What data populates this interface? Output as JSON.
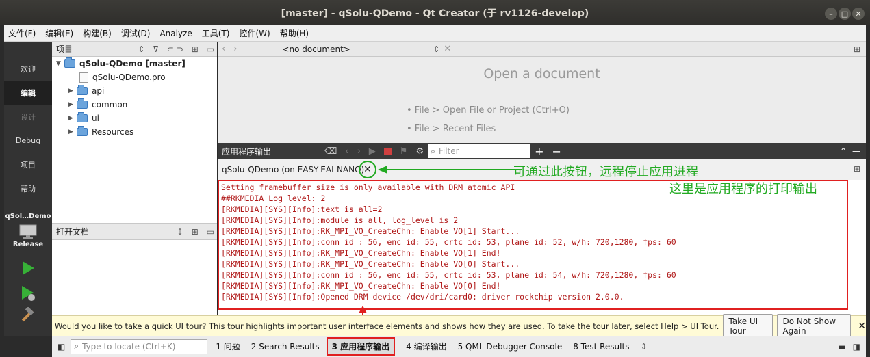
{
  "window": {
    "title": "[master] - qSolu-QDemo - Qt Creator (于 rv1126-develop)"
  },
  "menu": [
    "文件(F)",
    "编辑(E)",
    "构建(B)",
    "调试(D)",
    "Analyze",
    "工具(T)",
    "控件(W)",
    "帮助(H)"
  ],
  "modes": [
    {
      "label": "欢迎",
      "state": "normal"
    },
    {
      "label": "编辑",
      "state": "active"
    },
    {
      "label": "设计",
      "state": "dim"
    },
    {
      "label": "Debug",
      "state": "normal"
    },
    {
      "label": "项目",
      "state": "normal"
    },
    {
      "label": "帮助",
      "state": "normal"
    }
  ],
  "kit": {
    "project": "qSol…Demo",
    "build": "Release"
  },
  "projects": {
    "header": "项目",
    "root": "qSolu-QDemo [master]",
    "items": [
      "qSolu-QDemo.pro",
      "api",
      "common",
      "ui",
      "Resources"
    ]
  },
  "open_docs": {
    "header": "打开文档"
  },
  "editor": {
    "doc_selector": "<no document>",
    "title": "Open a document",
    "hints": [
      "• File > Open File or Project (Ctrl+O)",
      "• File > Recent Files"
    ]
  },
  "output": {
    "header": "应用程序输出",
    "filter_placeholder": "Filter",
    "tab": "qSolu-QDemo (on EASY-EAI-NANO)",
    "lines": [
      "Setting framebuffer size is only available with DRM atomic API",
      "##RKMEDIA Log level: 2",
      "[RKMEDIA][SYS][Info]:text is all=2",
      "[RKMEDIA][SYS][Info]:module is all, log_level is 2",
      "[RKMEDIA][SYS][Info]:RK_MPI_VO_CreateChn: Enable VO[1] Start...",
      "[RKMEDIA][SYS][Info]:conn id : 56, enc id: 55, crtc id: 53, plane id: 52, w/h: 720,1280, fps: 60",
      "[RKMEDIA][SYS][Info]:RK_MPI_VO_CreateChn: Enable VO[1] End!",
      "[RKMEDIA][SYS][Info]:RK_MPI_VO_CreateChn: Enable VO[0] Start...",
      "[RKMEDIA][SYS][Info]:conn id : 56, enc id: 55, crtc id: 53, plane id: 54, w/h: 720,1280, fps: 60",
      "[RKMEDIA][SYS][Info]:RK_MPI_VO_CreateChn: Enable VO[0] End!",
      "[RKMEDIA][SYS][Info]:Opened DRM device /dev/dri/card0: driver rockchip version 2.0.0."
    ]
  },
  "annotations": {
    "stop_hint": "可通过此按钮，远程停止应用进程",
    "output_hint": "这里是应用程序的打印输出"
  },
  "tour": {
    "message": "Would you like to take a quick UI tour? This tour highlights important user interface elements and shows how they are used. To take the tour later, select Help > UI Tour.",
    "take": "Take UI Tour",
    "dismiss": "Do Not Show Again"
  },
  "status": {
    "locate_placeholder": "Type to locate (Ctrl+K)",
    "panes": [
      "1  问题",
      "2  Search Results",
      "3  应用程序输出",
      "4  编译输出",
      "5  QML Debugger Console",
      "8  Test Results"
    ]
  },
  "colors": {
    "annotation_green": "#22aa22",
    "highlight_red": "#e02020",
    "log_text": "#b01818"
  }
}
